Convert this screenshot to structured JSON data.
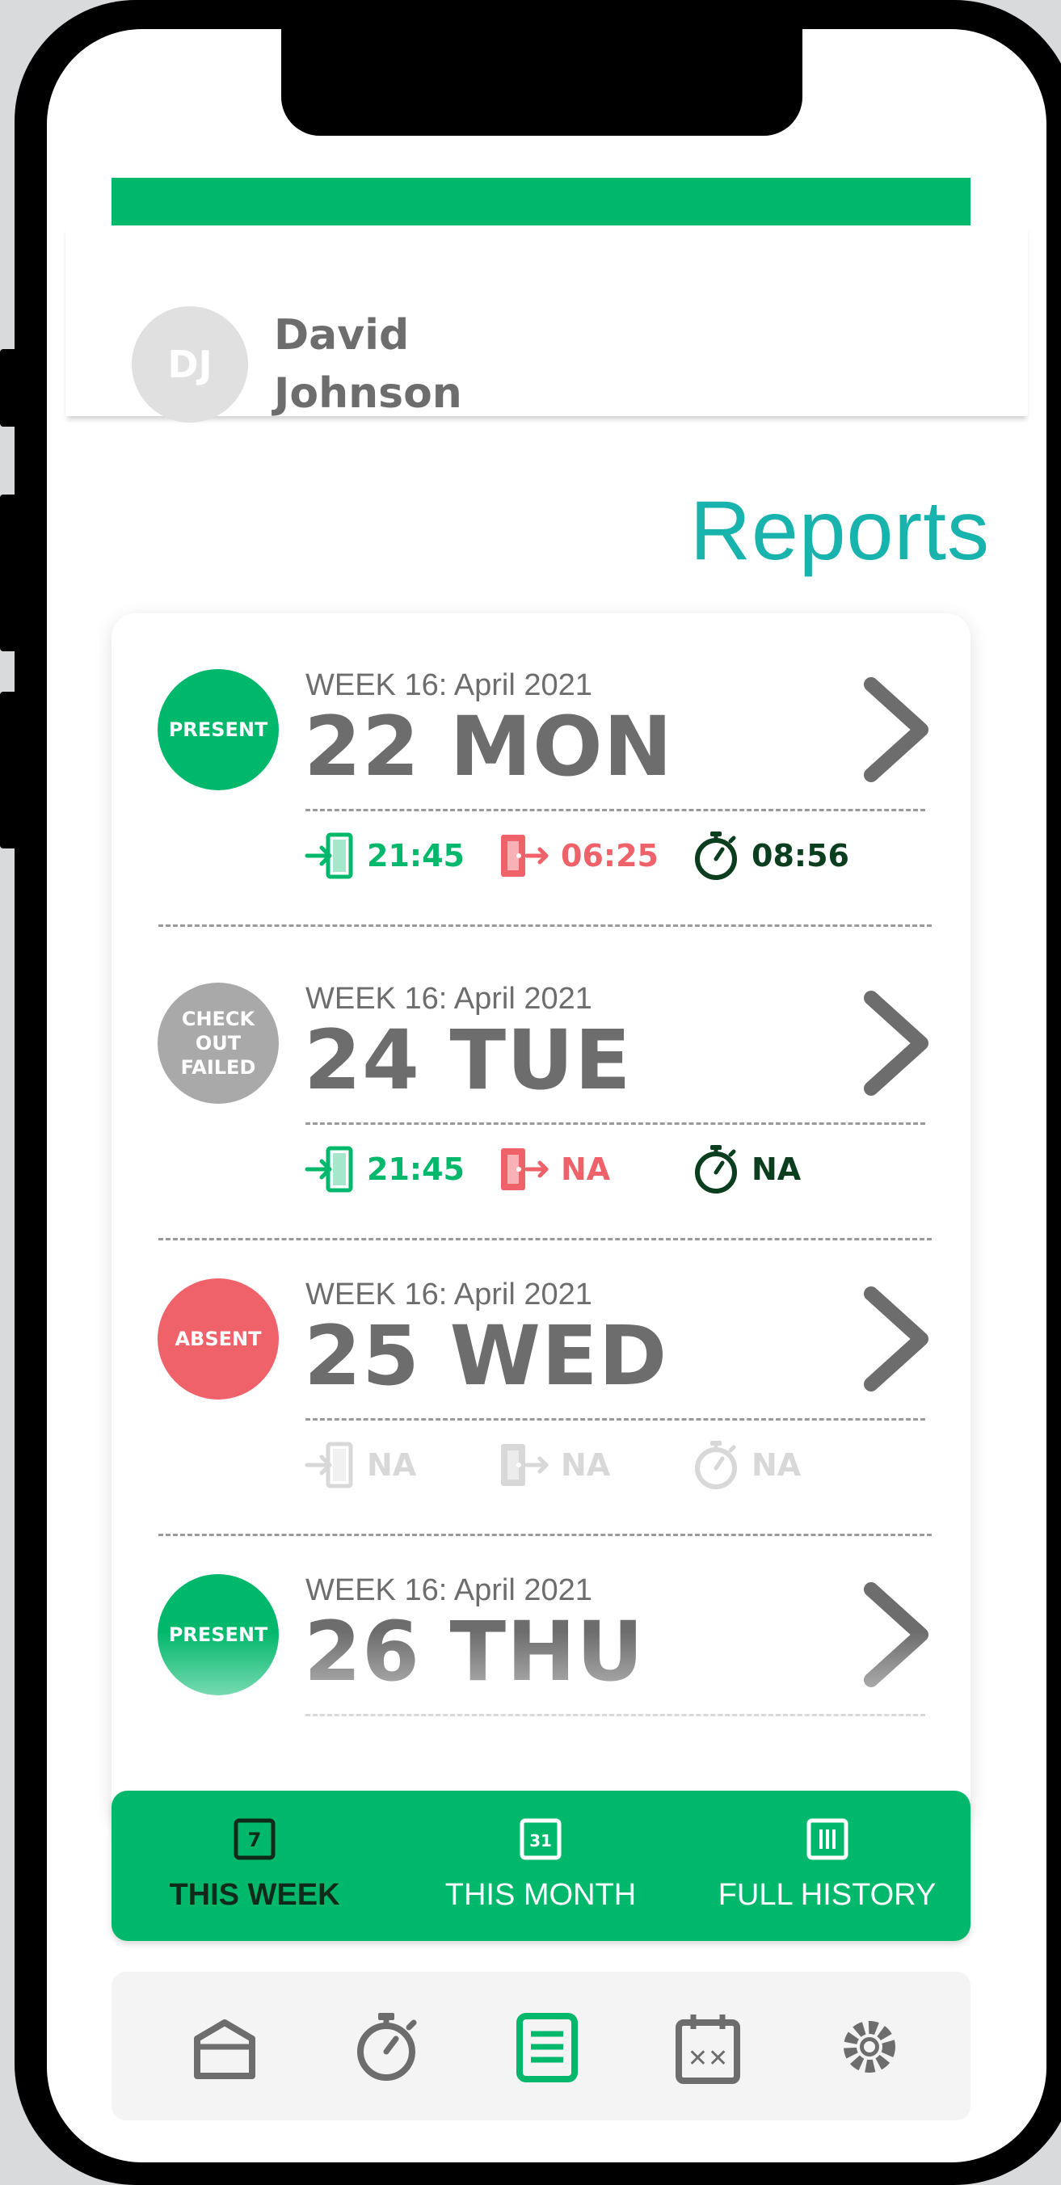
{
  "user": {
    "initials": "DJ",
    "first_name": "David",
    "last_name": "Johnson"
  },
  "page": {
    "title": "Reports"
  },
  "colors": {
    "green": "#00b86b",
    "red": "#f0626a",
    "gray": "#a9a9a9",
    "teal": "#18b3ad",
    "dark": "#0b3d1f"
  },
  "reports": [
    {
      "status": "PRESENT",
      "status_color": "#00b86b",
      "week": "WEEK 16: April 2021",
      "day": "22 MON",
      "check_in": "21:45",
      "check_out": "06:25",
      "duration": "08:56",
      "muted": false
    },
    {
      "status": "CHECK OUT FAILED",
      "status_color": "#a9a9a9",
      "week": "WEEK 16: April 2021",
      "day": "24 TUE",
      "check_in": "21:45",
      "check_out": "NA",
      "duration": "NA",
      "muted": false
    },
    {
      "status": "ABSENT",
      "status_color": "#f0626a",
      "week": "WEEK 16: April 2021",
      "day": "25 WED",
      "check_in": "NA",
      "check_out": "NA",
      "duration": "NA",
      "muted": true
    },
    {
      "status": "PRESENT",
      "status_color": "#00b86b",
      "week": "WEEK 16: April 2021",
      "day": "26 THU",
      "check_in": "",
      "check_out": "",
      "duration": "",
      "muted": false
    }
  ],
  "tabs": [
    {
      "label": "THIS WEEK",
      "icon": "calendar-7-icon",
      "icon_text": "7",
      "active": true
    },
    {
      "label": "THIS MONTH",
      "icon": "calendar-31-icon",
      "icon_text": "31",
      "active": false
    },
    {
      "label": "FULL HISTORY",
      "icon": "history-columns-icon",
      "icon_text": "",
      "active": false
    }
  ],
  "bottom_nav": [
    {
      "name": "home-icon",
      "active": false
    },
    {
      "name": "stopwatch-icon",
      "active": false
    },
    {
      "name": "reports-icon",
      "active": true
    },
    {
      "name": "calendar-icon",
      "active": false
    },
    {
      "name": "settings-icon",
      "active": false
    }
  ]
}
